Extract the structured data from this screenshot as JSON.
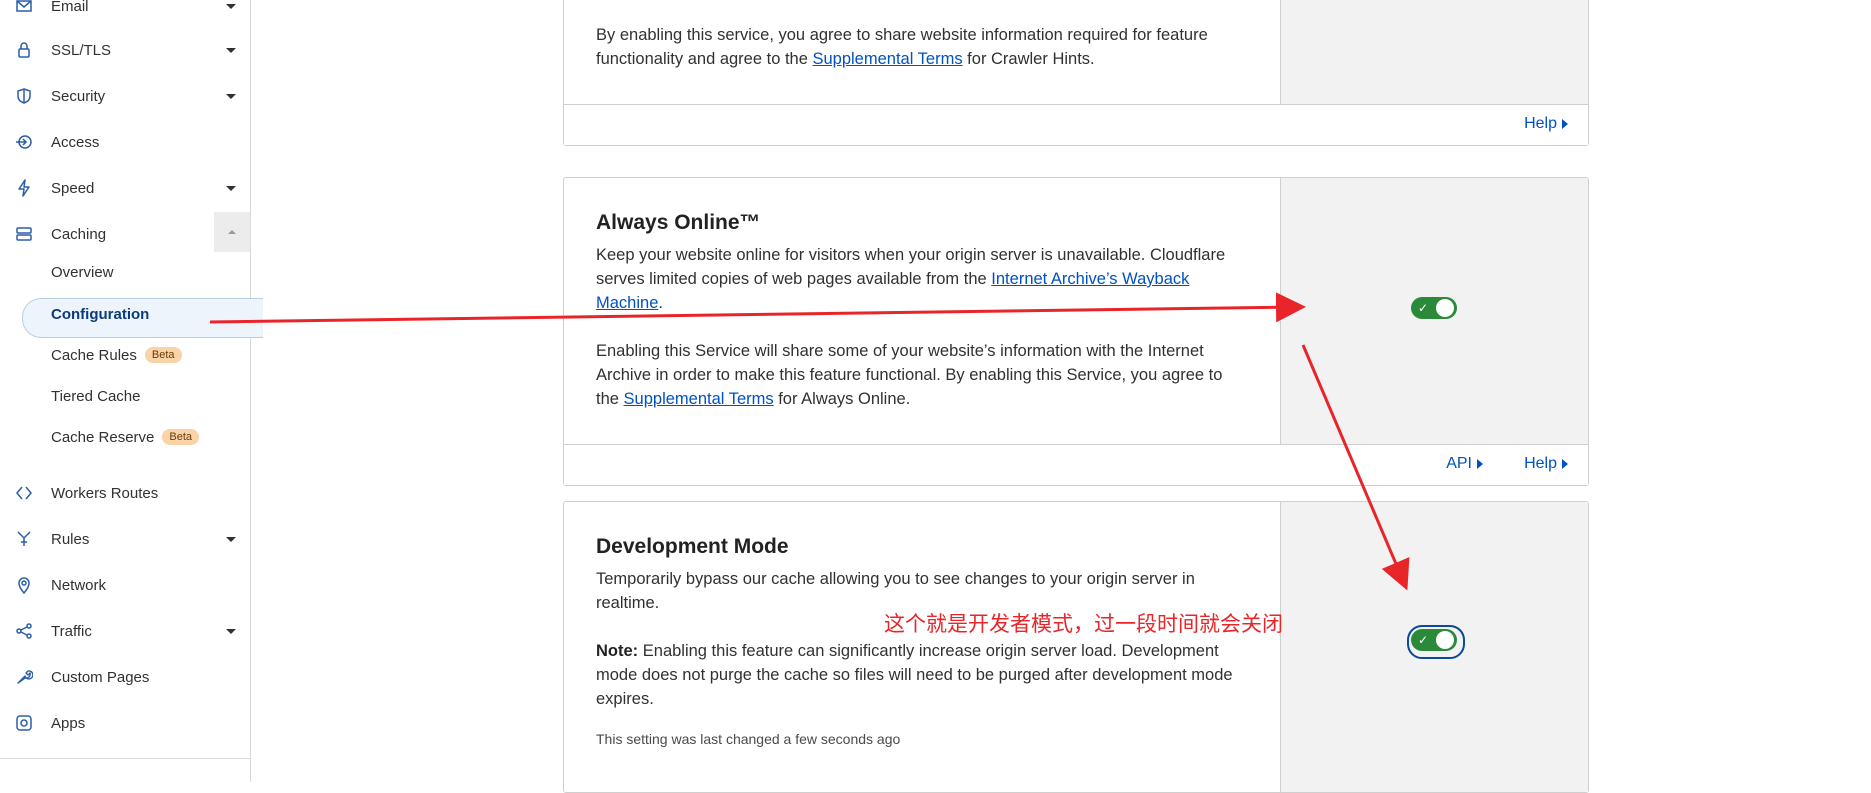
{
  "sidebar": {
    "items": [
      {
        "label": "Email",
        "icon": "email-icon",
        "has_caret": true
      },
      {
        "label": "SSL/TLS",
        "icon": "lock-icon",
        "has_caret": true
      },
      {
        "label": "Security",
        "icon": "shield-icon",
        "has_caret": true
      },
      {
        "label": "Access",
        "icon": "access-icon",
        "has_caret": false
      },
      {
        "label": "Speed",
        "icon": "lightning-icon",
        "has_caret": true
      },
      {
        "label": "Caching",
        "icon": "storage-icon",
        "expanded": true
      },
      {
        "label": "Workers Routes",
        "icon": "workers-icon",
        "has_caret": false
      },
      {
        "label": "Rules",
        "icon": "rules-icon",
        "has_caret": true
      },
      {
        "label": "Network",
        "icon": "location-pin-icon",
        "has_caret": false
      },
      {
        "label": "Traffic",
        "icon": "traffic-icon",
        "has_caret": true
      },
      {
        "label": "Custom Pages",
        "icon": "wrench-icon",
        "has_caret": false
      },
      {
        "label": "Apps",
        "icon": "apps-icon",
        "has_caret": false
      }
    ],
    "caching_sub": [
      {
        "label": "Overview"
      },
      {
        "label": "Configuration",
        "active": true
      },
      {
        "label": "Cache Rules",
        "badge": "Beta"
      },
      {
        "label": "Tiered Cache"
      },
      {
        "label": "Cache Reserve",
        "badge": "Beta"
      }
    ]
  },
  "crawler_card": {
    "text_before": "By enabling this service, you agree to share website information required for feature functionality and agree to the ",
    "link": "Supplemental Terms",
    "text_after": " for Crawler Hints.",
    "help": "Help"
  },
  "always_online_card": {
    "title": "Always Online™",
    "p1_before": "Keep your website online for visitors when your origin server is unavailable. Cloudflare serves limited copies of web pages available from the ",
    "p1_link": "Internet Archive’s Wayback Machine",
    "p1_after": ".",
    "p2_before": "Enabling this Service will share some of your website’s information with the Internet Archive in order to make this feature functional. By enabling this Service, you agree to the ",
    "p2_link": "Supplemental Terms",
    "p2_after": " for Always Online.",
    "toggle_on": true,
    "api": "API",
    "help": "Help"
  },
  "dev_mode_card": {
    "title": "Development Mode",
    "p1": "Temporarily bypass our cache allowing you to see changes to your origin server in realtime.",
    "note_label": "Note:",
    "note_text": " Enabling this feature can significantly increase origin server load. Development mode does not purge the cache so files will need to be purged after development mode expires.",
    "last_changed": "This setting was last changed a few seconds ago",
    "toggle_on": true
  },
  "annotation": {
    "text": "这个就是开发者模式，过一段时间就会关闭",
    "color": "#e8262a"
  },
  "colors": {
    "link": "#0051c3",
    "toggle_on": "#2a8a3a",
    "beta_badge": "#fbd3a8"
  }
}
